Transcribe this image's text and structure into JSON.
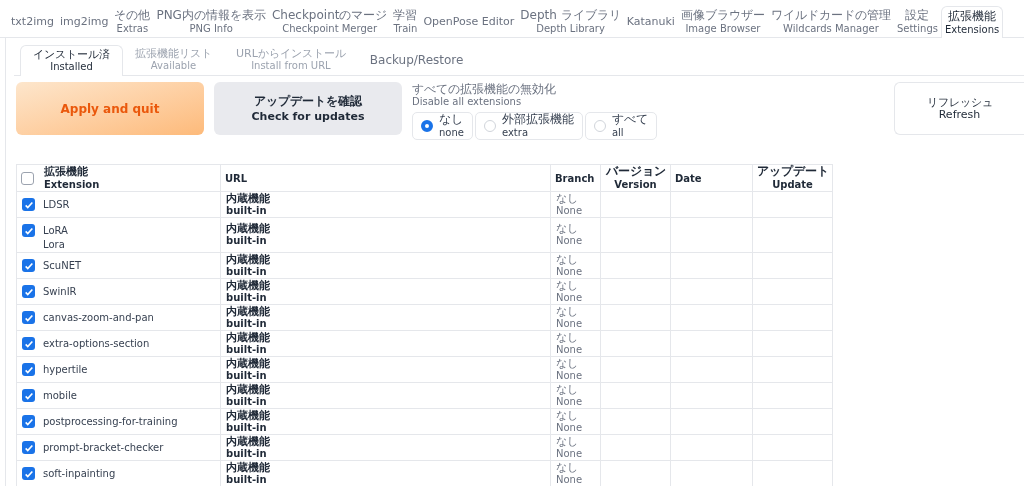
{
  "top_tabs": [
    {
      "label": "txt2img",
      "selected": false
    },
    {
      "label": "img2img",
      "selected": false
    },
    {
      "label": "その他",
      "sublabel": "Extras",
      "selected": false
    },
    {
      "label": "PNG内の情報を表示",
      "sublabel": "PNG Info",
      "selected": false
    },
    {
      "label": "Checkpointのマージ",
      "sublabel": "Checkpoint Merger",
      "selected": false
    },
    {
      "label": "学習",
      "sublabel": "Train",
      "selected": false
    },
    {
      "label": "OpenPose Editor",
      "selected": false
    },
    {
      "label": "Depth ライブラリ",
      "sublabel": "Depth Library",
      "selected": false
    },
    {
      "label": "Katanuki",
      "selected": false
    },
    {
      "label": "画像ブラウザー",
      "sublabel": "Image Browser",
      "selected": false
    },
    {
      "label": "ワイルドカードの管理",
      "sublabel": "Wildcards Manager",
      "selected": false
    },
    {
      "label": "設定",
      "sublabel": "Settings",
      "selected": false
    },
    {
      "label": "拡張機能",
      "sublabel": "Extensions",
      "selected": true
    }
  ],
  "sub_tabs": [
    {
      "label": "インストール済",
      "sublabel": "Installed",
      "selected": true
    },
    {
      "label": "拡張機能リスト",
      "sublabel": "Available",
      "selected": false
    },
    {
      "label": "URLからインストール",
      "sublabel": "Install from URL",
      "selected": false
    },
    {
      "label": "Backup/Restore",
      "selected": false
    }
  ],
  "apply_button": "Apply and quit",
  "check_button": {
    "label": "アップデートを確認",
    "sublabel": "Check for updates"
  },
  "disable_all": {
    "label": "すべての拡張機能の無効化",
    "sublabel": "Disable all extensions",
    "options": [
      {
        "label": "なし",
        "sublabel": "none",
        "selected": true
      },
      {
        "label": "外部拡張機能",
        "sublabel": "extra",
        "selected": false
      },
      {
        "label": "すべて",
        "sublabel": "all",
        "selected": false
      }
    ]
  },
  "refresh_button": {
    "label": "リフレッシュ",
    "sublabel": "Refresh"
  },
  "table": {
    "select_all_checked": false,
    "columns": [
      {
        "label": "拡張機能",
        "sublabel": "Extension"
      },
      {
        "label": "URL"
      },
      {
        "label": "Branch"
      },
      {
        "label": "バージョン",
        "sublabel": "Version"
      },
      {
        "label": "Date"
      },
      {
        "label": "アップデート",
        "sublabel": "Update"
      }
    ],
    "rows": [
      {
        "name": "LDSR",
        "checked": true,
        "url": "内蔵機能",
        "url_sub": "built-in",
        "branch": "なし",
        "branch_sub": "None"
      },
      {
        "name": "LoRA",
        "alias": "Lora",
        "checked": true,
        "url": "内蔵機能",
        "url_sub": "built-in",
        "branch": "なし",
        "branch_sub": "None"
      },
      {
        "name": "ScuNET",
        "checked": true,
        "url": "内蔵機能",
        "url_sub": "built-in",
        "branch": "なし",
        "branch_sub": "None"
      },
      {
        "name": "SwinIR",
        "checked": true,
        "url": "内蔵機能",
        "url_sub": "built-in",
        "branch": "なし",
        "branch_sub": "None"
      },
      {
        "name": "canvas-zoom-and-pan",
        "checked": true,
        "url": "内蔵機能",
        "url_sub": "built-in",
        "branch": "なし",
        "branch_sub": "None"
      },
      {
        "name": "extra-options-section",
        "checked": true,
        "url": "内蔵機能",
        "url_sub": "built-in",
        "branch": "なし",
        "branch_sub": "None"
      },
      {
        "name": "hypertile",
        "checked": true,
        "url": "内蔵機能",
        "url_sub": "built-in",
        "branch": "なし",
        "branch_sub": "None"
      },
      {
        "name": "mobile",
        "checked": true,
        "url": "内蔵機能",
        "url_sub": "built-in",
        "branch": "なし",
        "branch_sub": "None"
      },
      {
        "name": "postprocessing-for-training",
        "checked": true,
        "url": "内蔵機能",
        "url_sub": "built-in",
        "branch": "なし",
        "branch_sub": "None"
      },
      {
        "name": "prompt-bracket-checker",
        "checked": true,
        "url": "内蔵機能",
        "url_sub": "built-in",
        "branch": "なし",
        "branch_sub": "None"
      },
      {
        "name": "soft-inpainting",
        "checked": true,
        "url": "内蔵機能",
        "url_sub": "built-in",
        "branch": "なし",
        "branch_sub": "None"
      }
    ]
  }
}
